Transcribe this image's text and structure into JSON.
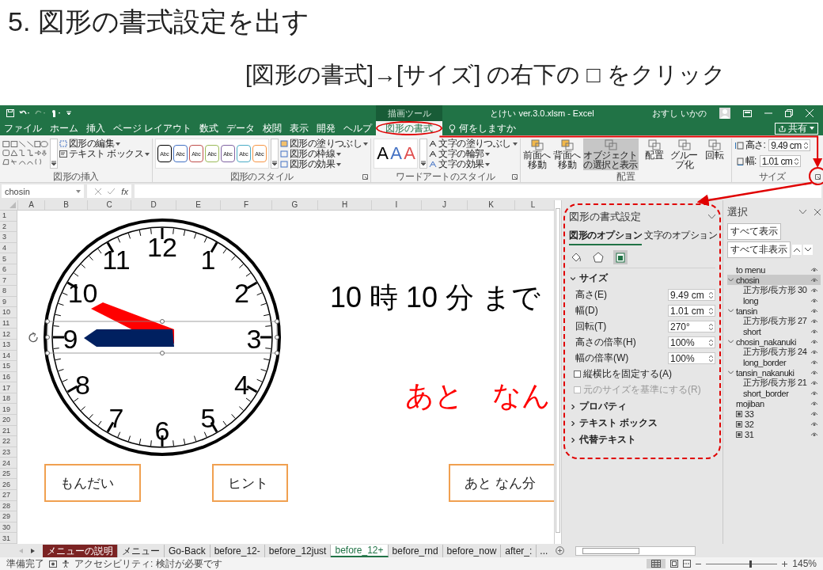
{
  "slide": {
    "title": "5. 図形の書式設定を出す",
    "instruction": "[図形の書式]→[サイズ] の右下の □ をクリック"
  },
  "window": {
    "context_group": "描画ツール",
    "title": "とけい ver.3.0.xlsm - Excel",
    "user": "おすし いかの"
  },
  "tabs": [
    {
      "label": "ファイル",
      "selected": false,
      "circled": false
    },
    {
      "label": "ホーム",
      "selected": false,
      "circled": false
    },
    {
      "label": "挿入",
      "selected": false,
      "circled": false
    },
    {
      "label": "ページ レイアウト",
      "selected": false,
      "circled": false
    },
    {
      "label": "数式",
      "selected": false,
      "circled": false
    },
    {
      "label": "データ",
      "selected": false,
      "circled": false
    },
    {
      "label": "校閲",
      "selected": false,
      "circled": false
    },
    {
      "label": "表示",
      "selected": false,
      "circled": false
    },
    {
      "label": "開発",
      "selected": false,
      "circled": false
    },
    {
      "label": "ヘルプ",
      "selected": false,
      "circled": false
    },
    {
      "label": "図形の書式",
      "selected": true,
      "circled": true
    }
  ],
  "tell_me": "何をしますか",
  "share": "共有",
  "ribbon": {
    "insert": {
      "label": "図形の挿入",
      "commands": [
        "図形の編集",
        "テキスト ボックス"
      ]
    },
    "shape_styles": {
      "label": "図形のスタイル",
      "presets": [
        {
          "text": "Abc",
          "color": "#000000"
        },
        {
          "text": "Abc",
          "color": "#4472c4"
        },
        {
          "text": "Abc",
          "color": "#c0504d"
        },
        {
          "text": "Abc",
          "color": "#9bbb59"
        },
        {
          "text": "Abc",
          "color": "#8064a2"
        },
        {
          "text": "Abc",
          "color": "#4bacc6"
        },
        {
          "text": "Abc",
          "color": "#f79646"
        }
      ],
      "commands": [
        "図形の塗りつぶし",
        "図形の枠線",
        "図形の効果"
      ]
    },
    "wordart": {
      "label": "ワードアートのスタイル",
      "presets": [
        {
          "text": "A",
          "color": "#000000"
        },
        {
          "text": "A",
          "color": "#4472c4"
        },
        {
          "text": "A",
          "color": "#e05050"
        }
      ],
      "commands": [
        "文字の塗りつぶし",
        "文字の輪郭",
        "文字の効果"
      ]
    },
    "arrange": {
      "label": "配置",
      "buttons": [
        {
          "label": "前面へ移動",
          "selected": false
        },
        {
          "label": "背面へ移動",
          "selected": false
        },
        {
          "label": "オブジェクトの選択と表示",
          "selected": true
        },
        {
          "label": "配置",
          "selected": false
        },
        {
          "label": "グループ化",
          "selected": false
        },
        {
          "label": "回転",
          "selected": false
        }
      ]
    },
    "size": {
      "label": "サイズ",
      "fields": [
        {
          "label": "高さ:",
          "value": "9.49 cm"
        },
        {
          "label": "幅:",
          "value": "1.01 cm"
        }
      ],
      "launcher_circled": true
    }
  },
  "formula_bar": {
    "name_box": "chosin",
    "function_label": "fx"
  },
  "sheet": {
    "columns": [
      "A",
      "B",
      "C",
      "D",
      "E",
      "F",
      "G",
      "H",
      "I",
      "J",
      "K",
      "L"
    ],
    "rows": [
      "1",
      "2",
      "3",
      "4",
      "5",
      "6",
      "7",
      "8",
      "9",
      "10",
      "11",
      "12",
      "13",
      "14",
      "15",
      "16",
      "17",
      "18",
      "19",
      "20",
      "21",
      "22",
      "23",
      "24",
      "25",
      "26",
      "27",
      "28",
      "29",
      "30",
      "31"
    ],
    "clock": {
      "numbers": [
        "12",
        "11",
        "1",
        "10",
        "2",
        "9",
        "3",
        "8",
        "4",
        "7",
        "5",
        "6"
      ],
      "hand_selected": true
    },
    "labels": [
      {
        "text": "10 時 10 分 まで",
        "color": "#000000"
      },
      {
        "text": "あと　なん",
        "color": "#ff0000"
      }
    ],
    "buttons": [
      "もんだい",
      "ヒント",
      "あと なん分"
    ]
  },
  "format_pane": {
    "title": "図形の書式設定",
    "circled": true,
    "tabs": [
      {
        "label": "図形のオプション",
        "selected": true
      },
      {
        "label": "文字のオプション",
        "selected": false
      }
    ],
    "icon_tabs": [
      {
        "kind": "fill",
        "selected": false
      },
      {
        "kind": "effects",
        "selected": false
      },
      {
        "kind": "size",
        "selected": true
      }
    ],
    "sections": [
      {
        "label": "サイズ",
        "expanded": true,
        "fields": [
          {
            "label": "高さ(E)",
            "value": "9.49 cm"
          },
          {
            "label": "幅(D)",
            "value": "1.01 cm"
          },
          {
            "label": "回転(T)",
            "value": "270°"
          },
          {
            "label": "高さの倍率(H)",
            "value": "100%"
          },
          {
            "label": "幅の倍率(W)",
            "value": "100%"
          }
        ],
        "checkboxes": [
          {
            "label": "縦横比を固定する(A)",
            "checked": false,
            "disabled": false
          },
          {
            "label": "元のサイズを基準にする(R)",
            "checked": false,
            "disabled": true
          }
        ]
      },
      {
        "label": "プロパティ",
        "expanded": false
      },
      {
        "label": "テキスト ボックス",
        "expanded": false
      },
      {
        "label": "代替テキスト",
        "expanded": false
      }
    ]
  },
  "selection_pane": {
    "title": "選択",
    "buttons": [
      "すべて表示",
      "すべて非表示"
    ],
    "items": [
      {
        "label": "to menu",
        "kind": "shape",
        "selected": false
      },
      {
        "label": "chosin",
        "kind": "group",
        "selected": true,
        "expanded": true,
        "children": [
          {
            "label": "正方形/長方形 30",
            "kind": "shape",
            "selected": false
          },
          {
            "label": "long",
            "kind": "shape",
            "selected": false
          }
        ]
      },
      {
        "label": "tansin",
        "kind": "group",
        "selected": false,
        "expanded": true,
        "children": [
          {
            "label": "正方形/長方形 27",
            "kind": "shape",
            "selected": false
          },
          {
            "label": "short",
            "kind": "shape",
            "selected": false
          }
        ]
      },
      {
        "label": "chosin_nakanuki",
        "kind": "group",
        "selected": false,
        "expanded": true,
        "children": [
          {
            "label": "正方形/長方形 24",
            "kind": "shape",
            "selected": false
          },
          {
            "label": "long_border",
            "kind": "shape",
            "selected": false
          }
        ]
      },
      {
        "label": "tansin_nakanuki",
        "kind": "group",
        "selected": false,
        "expanded": true,
        "children": [
          {
            "label": "正方形/長方形 21",
            "kind": "shape",
            "selected": false
          },
          {
            "label": "short_border",
            "kind": "shape",
            "selected": false
          }
        ]
      },
      {
        "label": "mojiban",
        "kind": "shape",
        "selected": false
      },
      {
        "label": "33",
        "kind": "picture",
        "selected": false
      },
      {
        "label": "32",
        "kind": "picture",
        "selected": false
      },
      {
        "label": "31",
        "kind": "picture",
        "selected": false
      }
    ]
  },
  "sheet_tabs": [
    {
      "label": "メニューの説明",
      "selected": false,
      "color": "#7b2323"
    },
    {
      "label": "メニュー",
      "selected": false
    },
    {
      "label": "Go-Back",
      "selected": false
    },
    {
      "label": "before_12-",
      "selected": false
    },
    {
      "label": "before_12just",
      "selected": false
    },
    {
      "label": "before_12+",
      "selected": true
    },
    {
      "label": "before_rnd",
      "selected": false
    },
    {
      "label": "before_now",
      "selected": false
    },
    {
      "label": "after_:",
      "selected": false
    }
  ],
  "more_tabs": "...",
  "status_bar": {
    "ready": "準備完了",
    "accessibility": "アクセシビリティ: 検討が必要です",
    "zoom": "145%",
    "zoom_slider": {
      "level": 0.62
    }
  }
}
